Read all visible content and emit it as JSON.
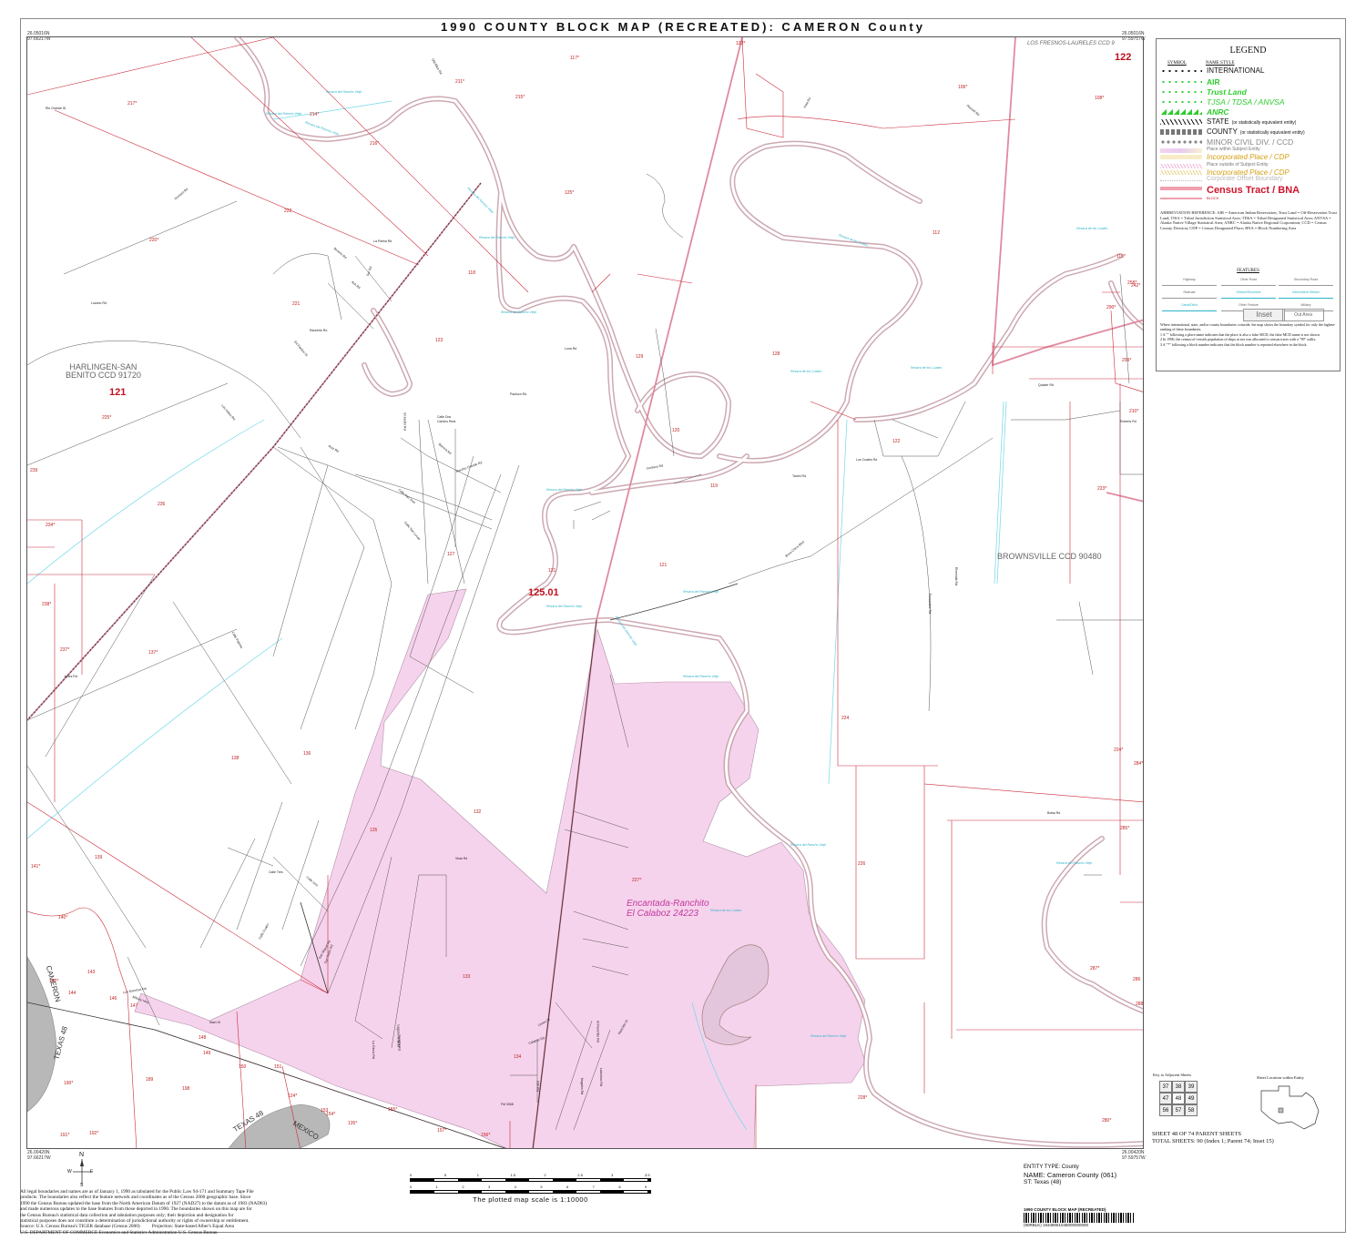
{
  "title": "1990 COUNTY BLOCK MAP (RECREATED): CAMERON County",
  "corners": {
    "top_left": [
      "26.05016N",
      "97.66217W"
    ],
    "top_right": [
      "26.05016N",
      "97.59757W"
    ],
    "bottom_left": [
      "26.00420N",
      "97.66217W"
    ],
    "bottom_right": [
      "26.00420N",
      "97.59757W"
    ]
  },
  "legend": {
    "title": "LEGEND",
    "symbol_header": "SYMBOL",
    "name_style_header": "NAME STYLE",
    "rows": [
      {
        "label": "INTERNATIONAL",
        "color": "#111111",
        "sym": "stars"
      },
      {
        "label": "AIR",
        "color": "#2ecc2e",
        "sym": "stars"
      },
      {
        "label": "Trust Land",
        "color": "#2ecc2e",
        "sym": "stars"
      },
      {
        "label": "TJSA / TDSA / ANVSA",
        "color": "#2ecc2e",
        "sym": "stars"
      },
      {
        "label": "ANRC",
        "color": "#2ecc2e",
        "sym": "triangles"
      },
      {
        "label": "STATE",
        "note": "(or statistically equivalent entity)",
        "color": "#111111",
        "sym": "slashes"
      },
      {
        "label": "COUNTY",
        "note": "(or statistically equivalent entity)",
        "color": "#111111",
        "sym": "squares"
      },
      {
        "label": "MINOR CIVIL DIV. / CCD",
        "color": "#888888",
        "sym": "dots"
      },
      {
        "label": "Place within Subject Entity",
        "color": "#777777",
        "sym": "fill-pink"
      },
      {
        "label": "Incorporated Place / CDP",
        "color": "#d4a017",
        "sym": "fill-yellow"
      },
      {
        "label": "Place outside of Subject Entity",
        "color": "#777777",
        "sym": "hatch-pink"
      },
      {
        "label": "Incorporated Place / CDP",
        "color": "#d4a017",
        "sym": "hatch-yellow"
      },
      {
        "label": "Corporate Offset Boundary",
        "color": "#bbbbbb",
        "sym": "dotted"
      },
      {
        "label": "Census Tract / BNA",
        "color": "#d0142c",
        "sym": "thick-pink"
      },
      {
        "label": "BLOCK",
        "color": "#d0142c",
        "sym": "thin-pink"
      }
    ],
    "abbreviation_reference": "ABBREVIATION REFERENCE: AIR = American Indian Reservation; Trust Land = Off-Reservation Trust Land; TISA = Tribal Jurisdiction Statistical Area; TDSA = Tribal Designated Statistical Area; ANVSA = Alaska Native Village Statistical Area; ANRC = Alaska Native Regional Corporation; CCD = Census County Division; CDP = Census Designated Place; BNA = Block Numbering Area",
    "features_header": "FEATURES",
    "features": [
      "Highway",
      "Other Road",
      "Secondary Road",
      "Railroad",
      "Stream/Shoreline",
      "Intermittent Stream",
      "Canal/Ditch",
      "Other Feature",
      "Military",
      "Inset",
      "Out Area"
    ],
    "notes": [
      "Where international, state, and/or county boundaries coincide, the map shows the boundary symbol for only the highest-ranking of these boundaries.",
      "1 A \"\" following a place name indicates that the place is also a false MCD; the false MCD name is not shown.",
      "2 In 1990, the census-of-vessels population of ships at sea was allocated to census tracts with a \"99\" suffix.",
      "3 A \"*\" following a block number indicates that the block number is repeated elsewhere in the block."
    ]
  },
  "map": {
    "tracts": [
      {
        "label": "121"
      },
      {
        "label": "125.01"
      },
      {
        "label": "122"
      }
    ],
    "ccds": [
      {
        "label": "HARLINGEN-SAN\nBENITO CCD 91720"
      },
      {
        "label": "BROWNSVILLE CCD 90480"
      },
      {
        "label": "LOS FRESNOS-LAURELES CCD 9"
      }
    ],
    "place": {
      "label": "Encantada-Ranchito\nEl Calaboz 24223"
    },
    "highways": [
      "TEXAS 48",
      "TEXAS 48",
      "MEXICO",
      "CAMERON"
    ],
    "blocks": [
      "217*",
      "214*",
      "216*",
      "211*",
      "215*",
      "117*",
      "122*",
      "222",
      "220*",
      "221",
      "118",
      "125*",
      "106*",
      "108*",
      "112",
      "110*",
      "123",
      "129",
      "120",
      "119",
      "128",
      "225*",
      "236",
      "234*",
      "238*",
      "237*",
      "137*",
      "127",
      "121",
      "121",
      "209*",
      "210*",
      "122",
      "223*",
      "138",
      "136",
      "135",
      "132",
      "139",
      "141*",
      "140*",
      "143",
      "142*",
      "144",
      "146",
      "147",
      "149",
      "148",
      "150",
      "151",
      "153",
      "154*",
      "155*",
      "157*",
      "156*",
      "134",
      "133",
      "227*",
      "224",
      "224*",
      "226",
      "228*",
      "284*",
      "285*",
      "286",
      "287*",
      "288*",
      "280*",
      "190*",
      "189",
      "191*",
      "192*",
      "135*",
      "124*",
      "239",
      "258*",
      "290*",
      "242*",
      "198"
    ],
    "roads": [
      "Orchard Rd",
      "Browns Rd",
      "Old Alice Rd",
      "Russell Rd",
      "Iowa Rd",
      "Rio Grande St",
      "Ed Pardee St",
      "Los Indios Rd",
      "Paulson Rd",
      "Tamm Rd",
      "Calle San Jose",
      "Calle San Lucas",
      "Calle Palomo",
      "Military Hwy",
      "FM 803",
      "FM 3068",
      "Dockery Rd",
      "Jones Rd",
      "Quaker Rd",
      "Roberts Rd",
      "Boca Chica Blvd",
      "Fernandez Rd",
      "Lozano Rd",
      "La Palma Rd",
      "Ruiz Rd",
      "Camino Real",
      "Bolsa Rd",
      "La Gloria Rd",
      "Sandpit Rd",
      "Cortez St",
      "Nogales Rd",
      "Laguna Vista Dr",
      "Ranchito Rd",
      "Los Cuates Rd",
      "Ash Rd",
      "Lona Rd",
      "Calle Tres",
      "Sur Rd",
      "Calle Uno",
      "Los Ranchos Rd",
      "San Miguel Rd",
      "Calle Dos",
      "Calle Cuatro",
      "Barrera Rd",
      "El Jardin Rd",
      "San Pedro Rd",
      "El Ranchito Rd",
      "Lakeview Rd",
      "Calaboz Rd",
      "Ranchito Dr",
      "Vista Rd",
      "Riverside Rd",
      "Main St",
      "Rancho Grande Rd"
    ],
    "waters": [
      "Resaca del Rancho Viejo",
      "Resaca del Rancho Viejo",
      "Resaca del Rancho Viejo",
      "Resaca del Rancho Viejo",
      "Resaca del Rancho Viejo",
      "Resaca de los Cuates",
      "Resaca de los Cuates",
      "Resaca de los Cuates",
      "Resaca de los Cuates",
      "Resaca del Rancho Viejo",
      "Resaca del Rancho Viejo",
      "Resaca del Rancho Viejo",
      "Resaca del Rancho Viejo",
      "Resaca del Rancho Viejo",
      "Resaca del Rancho Viejo",
      "Resaca del Rancho Viejo",
      "Resaca de los Cuates",
      "Resaca del Rancho Viejo",
      "Resaca del Rancho Viejo",
      "Resaca del Rancho Viejo"
    ]
  },
  "north_arrow": {
    "n": "N",
    "s": "S",
    "e": "E",
    "w": "W"
  },
  "scale": {
    "bar1_labels": [
      "0",
      ".5",
      "1",
      "1.5",
      "2",
      "2.5",
      "3",
      "3.5 mi"
    ],
    "bar2_labels": [
      "0",
      "1",
      "2",
      "3",
      "4",
      "5",
      "6",
      "7",
      "8",
      "9 km"
    ],
    "text": "The plotted map scale is 1:10000"
  },
  "disclaimer": [
    "All legal boundaries and names are as of January 1, 1990 as tabulated for the Public Law 94-171 and Summary Tape File",
    "products. The boundaries also reflect the feature network and coordinates as of the Census 2000 geographic base. Since",
    "1990 the Census Bureau updated the base from the North American Datum of 1927 (NAD27) to the datum as of 1983 (NAD83)",
    "and made numerous updates to the base features from those depicted in 1990. The boundaries shown on this map are for",
    "the Census Bureau's statistical data collection and tabulation purposes only; their depiction and designation for",
    "statistical purposes does not constitute a determination of jurisdictional authority or rights of ownership or entitlement.",
    "Source: U.S. Census Bureau's TIGER database (Census 2000)          Projection: State-based Alber's Equal Area",
    "U.S. DEPARTMENT OF COMMERCE Economics and Statistics Administration U.S. Census Bureau"
  ],
  "entity": {
    "type": "ENTITY TYPE: County",
    "name": "NAME: Cameron County (061)",
    "state": "ST: Texas (48)"
  },
  "barcode_title": "1990 COUNTY BLOCK MAP (RECREATED)",
  "barcode_code": "(90RBLK) 19348061048000000000",
  "key_sheets": {
    "title": "Key to Adjacent Sheets",
    "cells": [
      "37",
      "38",
      "39",
      "47",
      "48",
      "49",
      "56",
      "57",
      "58"
    ]
  },
  "sheet_location": {
    "title": "Sheet Location within Entity"
  },
  "sheet_info": {
    "line1": "SHEET 48 OF 74 PARENT SHEETS",
    "line2": "TOTAL SHEETS: 90 (Index 1; Parent 74; Inset 15)"
  }
}
